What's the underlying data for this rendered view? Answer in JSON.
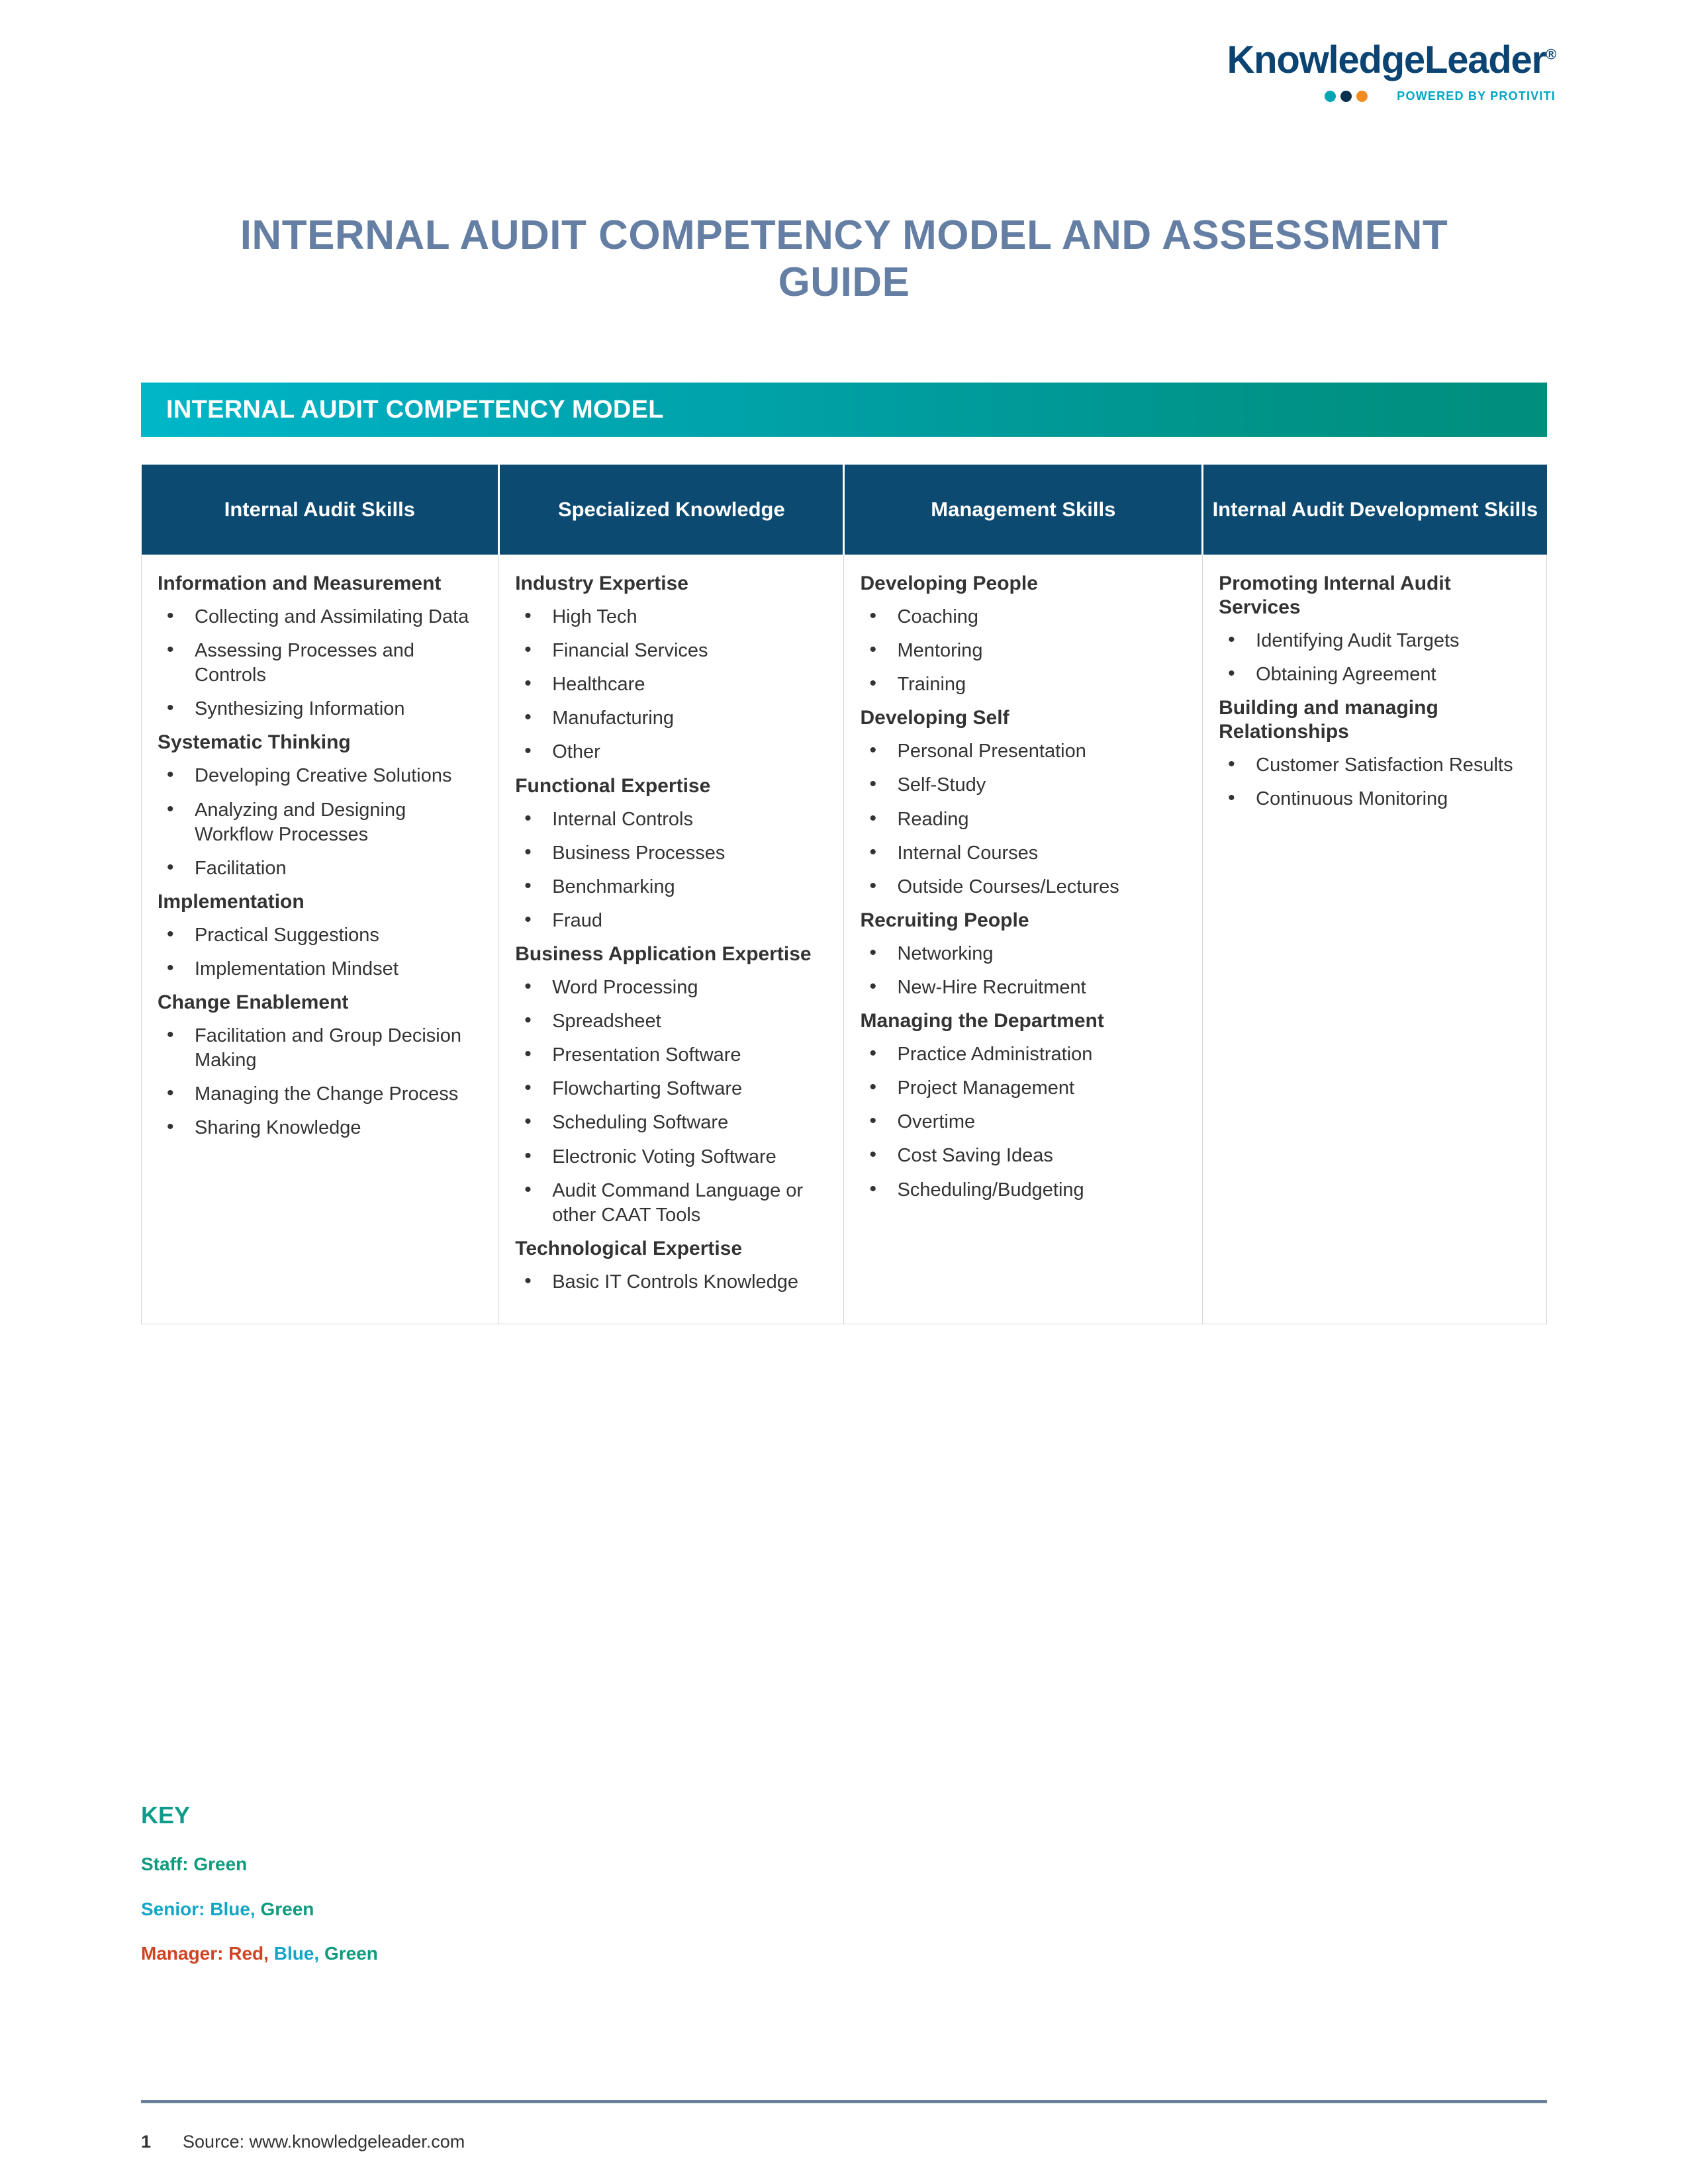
{
  "logo": {
    "wordmark": "KnowledgeLeader",
    "registered": "®",
    "tagline": "POWERED BY PROTIVITI",
    "dot_colors": [
      "#00A5B5",
      "#0B2F4E",
      "#F28C1E"
    ]
  },
  "document": {
    "title": "INTERNAL AUDIT COMPETENCY MODEL AND ASSESSMENT GUIDE"
  },
  "banner": {
    "label": "INTERNAL AUDIT COMPETENCY MODEL",
    "gradient_from": "#00B7C8",
    "gradient_to": "#008E7D"
  },
  "table": {
    "header_bg": "#0C4A71",
    "columns": [
      {
        "header": "Internal Audit Skills"
      },
      {
        "header": "Specialized Knowledge"
      },
      {
        "header": "Management Skills"
      },
      {
        "header": "Internal Audit Development Skills"
      }
    ],
    "column1": [
      {
        "heading": "Information and Measurement",
        "items": [
          {
            "text": "Collecting and Assimilating Data",
            "color": "green"
          },
          {
            "text": "Assessing Processes and Controls",
            "color": "green"
          },
          {
            "text": "Synthesizing Information",
            "color": "blue"
          }
        ]
      },
      {
        "heading": "Systematic Thinking",
        "items": [
          {
            "text": "Developing Creative Solutions",
            "color": "blue"
          },
          {
            "text": "Analyzing and Designing Workflow Processes",
            "color": "green"
          },
          {
            "text": "Facilitation",
            "color": "blue"
          }
        ]
      },
      {
        "heading": "Implementation",
        "items": [
          {
            "text": "Practical Suggestions",
            "color": "blue"
          },
          {
            "text": "Implementation Mindset",
            "color": "red"
          }
        ]
      },
      {
        "heading": "Change Enablement",
        "items": [
          {
            "text": "Facilitation and Group Decision Making",
            "color": "blue"
          },
          {
            "text": "Managing the Change Process",
            "color": "red"
          },
          {
            "text": "Sharing Knowledge",
            "color": "red"
          }
        ]
      }
    ],
    "column2": [
      {
        "heading": "Industry Expertise",
        "items": [
          {
            "text": "High Tech",
            "color": "dark"
          },
          {
            "text": "Financial Services",
            "color": "dark"
          },
          {
            "text": "Healthcare",
            "color": "dark"
          },
          {
            "text": "Manufacturing",
            "color": "dark"
          },
          {
            "text": "Other",
            "color": "dark"
          }
        ]
      },
      {
        "heading": "Functional Expertise",
        "items": [
          {
            "text": "Internal Controls",
            "color": "green"
          },
          {
            "text": "Business Processes",
            "color": "green"
          },
          {
            "text": "Benchmarking",
            "color": "green"
          },
          {
            "text": "Fraud",
            "color": "blue"
          }
        ]
      },
      {
        "heading": "Business Application Expertise",
        "items": [
          {
            "text": "Word Processing",
            "color": "green"
          },
          {
            "text": "Spreadsheet",
            "color": "green"
          },
          {
            "text": "Presentation Software",
            "color": "green"
          },
          {
            "text": "Flowcharting Software",
            "color": "green"
          },
          {
            "text": "Scheduling Software",
            "color": "green"
          },
          {
            "text": "Electronic Voting Software",
            "color": "blue"
          },
          {
            "text": "Audit Command Language or other CAAT Tools",
            "color": "blue"
          }
        ]
      },
      {
        "heading": "Technological Expertise",
        "items": [
          {
            "text": "Basic IT Controls Knowledge",
            "color": "green"
          }
        ]
      }
    ],
    "column3": [
      {
        "heading": "Developing People",
        "items": [
          {
            "text": "Coaching",
            "color": "blue"
          },
          {
            "text": "Mentoring",
            "color": "green"
          },
          {
            "text": "Training",
            "color": "red"
          }
        ]
      },
      {
        "heading": "Developing Self",
        "items": [
          {
            "text": "Personal Presentation",
            "color": "green"
          },
          {
            "text": "Self-Study",
            "color": "green"
          },
          {
            "text": "Reading",
            "color": "green"
          },
          {
            "text": "Internal Courses",
            "color": "green"
          },
          {
            "text": "Outside Courses/Lectures",
            "color": "blue"
          }
        ]
      },
      {
        "heading": "Recruiting People",
        "items": [
          {
            "text": "Networking",
            "color": "green"
          },
          {
            "text": "New-Hire Recruitment",
            "color": "green"
          }
        ]
      },
      {
        "heading": "Managing the Department",
        "items": [
          {
            "text": "Practice Administration",
            "color": "red"
          },
          {
            "text": "Project Management",
            "color": "red"
          },
          {
            "text": "Overtime",
            "color": "green"
          },
          {
            "text": "Cost Saving Ideas",
            "color": "blue"
          },
          {
            "text": "Scheduling/Budgeting",
            "color": "blue"
          }
        ]
      }
    ],
    "column4": [
      {
        "heading": "Promoting Internal Audit Services",
        "items": [
          {
            "text": "Identifying Audit Targets",
            "color": "red"
          },
          {
            "text": "Obtaining Agreement",
            "color": "red"
          }
        ]
      },
      {
        "heading": "Building and managing Relationships",
        "items": [
          {
            "text": "Customer Satisfaction Results",
            "color": "green"
          },
          {
            "text": "Continuous Monitoring",
            "color": "red"
          }
        ]
      }
    ]
  },
  "key": {
    "title": "KEY",
    "staff_label": "Staff: ",
    "staff_value": "Green",
    "senior_label": "Senior: ",
    "senior_blue": "Blue",
    "senior_sep": ", ",
    "senior_green": "Green",
    "manager_label": "Manager: ",
    "manager_red": "Red",
    "manager_sep1": ", ",
    "manager_blue": "Blue",
    "manager_sep2": ", ",
    "manager_green": "Green"
  },
  "footer": {
    "page_number": "1",
    "source": "Source: www.knowledgeleader.com"
  },
  "colors": {
    "green": "#0E9B7E",
    "blue": "#13A5C6",
    "red": "#CF4422",
    "navy": "#0C4A71",
    "title_blue": "#657FA4"
  }
}
